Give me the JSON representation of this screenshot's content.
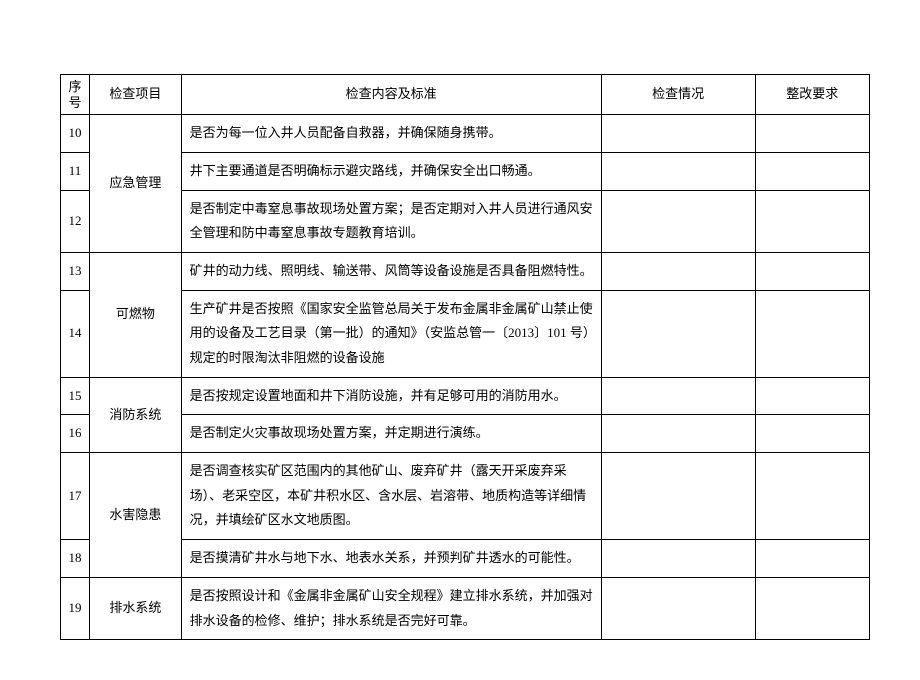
{
  "headers": {
    "seq": "序号",
    "item": "检查项目",
    "std": "检查内容及标准",
    "stat": "检查情况",
    "req": "整改要求"
  },
  "rows": [
    {
      "seq": "10",
      "std": "是否为每一位入井人员配备自救器，并确保随身携带。"
    },
    {
      "seq": "11",
      "std": "井下主要通道是否明确标示避灾路线，并确保安全出口畅通。"
    },
    {
      "seq": "12",
      "std": "是否制定中毒窒息事故现场处置方案；是否定期对入井人员进行通风安全管理和防中毒窒息事故专题教育培训。"
    },
    {
      "seq": "13",
      "std": "矿井的动力线、照明线、输送带、风筒等设备设施是否具备阻燃特性。"
    },
    {
      "seq": "14",
      "std": "生产矿井是否按照《国家安全监管总局关于发布金属非金属矿山禁止使用的设备及工艺目录（第一批）的通知》（安监总管一〔2013〕101 号）规定的时限淘汰非阻燃的设备设施"
    },
    {
      "seq": "15",
      "std": "是否按规定设置地面和井下消防设施，并有足够可用的消防用水。"
    },
    {
      "seq": "16",
      "std": "是否制定火灾事故现场处置方案，并定期进行演练。"
    },
    {
      "seq": "17",
      "std": "是否调查核实矿区范围内的其他矿山、废弃矿井（露天开采废弃采场）、老采空区，本矿井积水区、含水层、岩溶带、地质构造等详细情况，并填绘矿区水文地质图。"
    },
    {
      "seq": "18",
      "std": "是否摸清矿井水与地下水、地表水关系，并预判矿井透水的可能性。"
    },
    {
      "seq": "19",
      "std": "是否按照设计和《金属非金属矿山安全规程》建立排水系统，并加强对排水设备的检修、维护；排水系统是否完好可靠。"
    }
  ],
  "groups": {
    "emergency": "应急管理",
    "combustible": "可燃物",
    "fire": "消防系统",
    "water_hazard": "水害隐患",
    "drainage": "排水系统"
  }
}
